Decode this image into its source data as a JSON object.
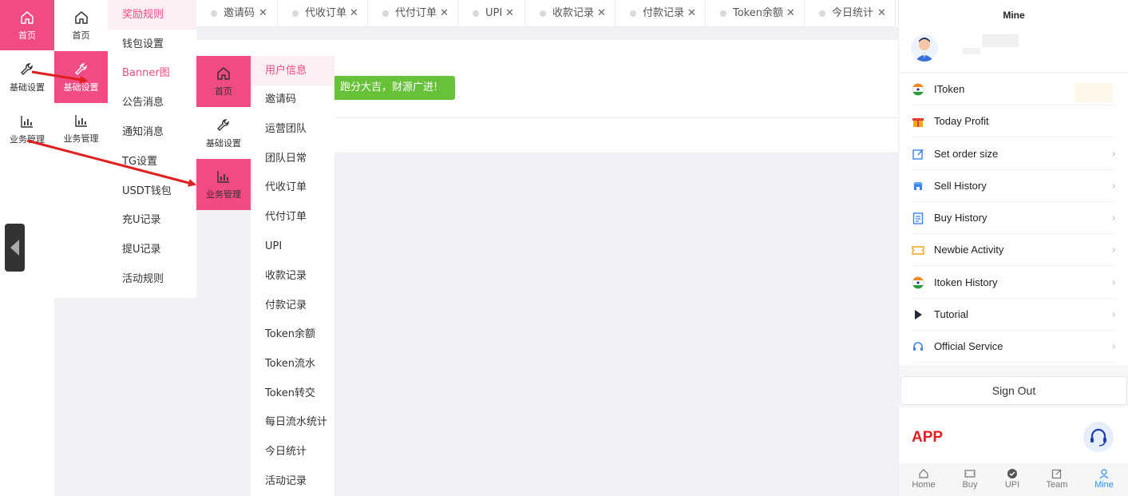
{
  "rail1": {
    "items": [
      {
        "label": "首页",
        "icon": "home-icon",
        "active": true
      },
      {
        "label": "基础设置",
        "icon": "wrench-icon",
        "active": false
      },
      {
        "label": "业务管理",
        "icon": "chart-icon",
        "active": false
      }
    ]
  },
  "rail2": {
    "items": [
      {
        "label": "首页",
        "icon": "home-icon",
        "active": false
      },
      {
        "label": "基础设置",
        "icon": "wrench-icon",
        "active": true
      },
      {
        "label": "业务管理",
        "icon": "chart-icon",
        "active": false
      }
    ]
  },
  "submenu1": {
    "items": [
      "奖励规则",
      "钱包设置",
      "Banner图",
      "公告消息",
      "通知消息",
      "TG设置",
      "USDT钱包",
      "充U记录",
      "提U记录",
      "活动规则"
    ]
  },
  "rail3": {
    "items": [
      {
        "label": "首页",
        "icon": "home-icon",
        "active": true
      },
      {
        "label": "基础设置",
        "icon": "wrench-icon",
        "active": false
      },
      {
        "label": "业务管理",
        "icon": "chart-icon",
        "active": true
      }
    ]
  },
  "submenu2": {
    "items": [
      "用户信息",
      "邀请码",
      "运营团队",
      "团队日常",
      "代收订单",
      "代付订单",
      "UPI",
      "收款记录",
      "付款记录",
      "Token余额",
      "Token流水",
      "Token转交",
      "每日流水统计",
      "今日统计",
      "活动记录"
    ]
  },
  "tabs": [
    "邀请码",
    "代收订单",
    "代付订单",
    "UPI",
    "收款记录",
    "付款记录",
    "Token余额",
    "今日统计"
  ],
  "toast": "跑分大吉，财源广进!",
  "phone": {
    "title": "Mine",
    "menu": [
      {
        "label": "IToken",
        "icon": "india-flag-icon"
      },
      {
        "label": "Today Profit",
        "icon": "gift-icon"
      },
      {
        "label": "Set order size",
        "icon": "edit-icon"
      },
      {
        "label": "Sell History",
        "icon": "store-icon"
      },
      {
        "label": "Buy History",
        "icon": "clipboard-icon"
      },
      {
        "label": "Newbie Activity",
        "icon": "ticket-icon"
      },
      {
        "label": "Itoken History",
        "icon": "india-flag-icon"
      },
      {
        "label": "Tutorial",
        "icon": "play-icon"
      },
      {
        "label": "Official Service",
        "icon": "headset-icon"
      }
    ],
    "signout": "Sign Out",
    "app_label": "APP",
    "nav": [
      {
        "label": "Home",
        "icon": "home-icon"
      },
      {
        "label": "Buy",
        "icon": "ticket-icon"
      },
      {
        "label": "UPI",
        "icon": "check-circle-icon"
      },
      {
        "label": "Team",
        "icon": "edit-icon"
      },
      {
        "label": "Mine",
        "icon": "user-icon"
      }
    ]
  },
  "colors": {
    "accent": "#f04b82",
    "toast": "#67c23a",
    "arrow": "#e02020",
    "app": "#e02020",
    "nav_active": "#2f8cf5"
  }
}
